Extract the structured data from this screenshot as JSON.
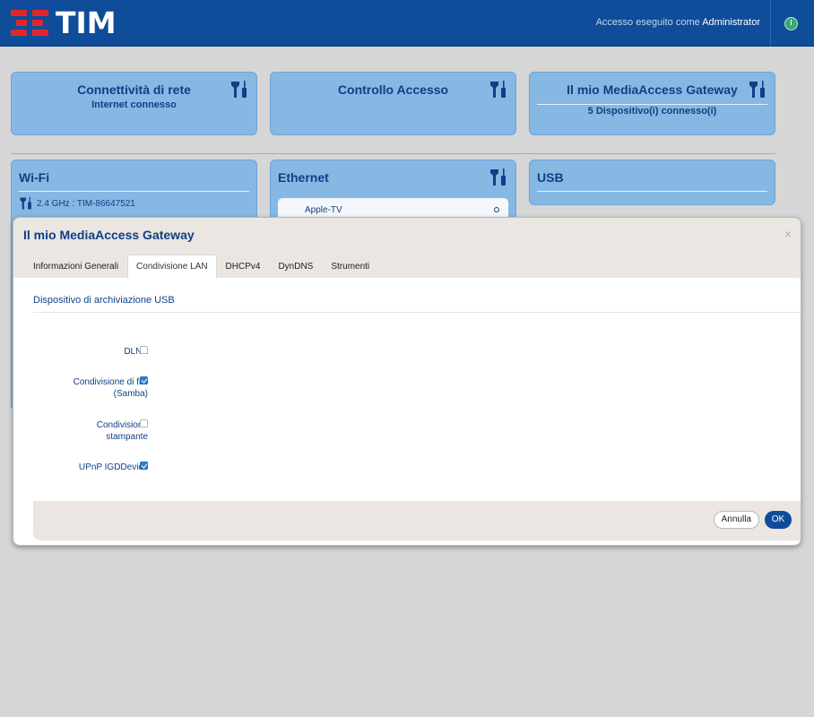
{
  "header": {
    "brand": "TIM",
    "login_prefix": "Accesso eseguito come",
    "login_user": "Administrator"
  },
  "cards": {
    "network": {
      "title": "Connettività di rete",
      "subtitle": "Internet connesso"
    },
    "access": {
      "title": "Controllo Accesso"
    },
    "gateway": {
      "title": "Il mio MediaAccess Gateway",
      "subtitle": "5 Dispositivo(i) connesso(i)"
    },
    "wifi": {
      "title": "Wi-Fi",
      "network": "2.4 GHz : TIM-86647521"
    },
    "ethernet": {
      "title": "Ethernet",
      "device": "Apple-TV"
    },
    "usb": {
      "title": "USB"
    }
  },
  "modal": {
    "title": "Il mio MediaAccess Gateway",
    "close": "×",
    "tabs": [
      "Informazioni Generali",
      "Condivisione LAN",
      "DHCPv4",
      "DynDNS",
      "Strumenti"
    ],
    "active_tab": "Condivisione LAN",
    "section_title": "Dispositivo di archiviazione USB",
    "options": [
      {
        "label": "DLNA",
        "checked": false
      },
      {
        "label": "Condivisione di file (Samba)",
        "checked": true
      },
      {
        "label": "Condivisione stampante",
        "checked": false
      },
      {
        "label": "UPnP IGDDevice",
        "checked": true
      }
    ],
    "cancel_label": "Annulla",
    "ok_label": "OK"
  },
  "colors": {
    "header_bg": "#0f4c99",
    "card_bg": "#86b8e4",
    "accent": "#0f3f86",
    "brand_red": "#e3262d"
  },
  "icons": [
    "tools-icon",
    "power-icon",
    "close-icon",
    "radio-dot-icon"
  ]
}
